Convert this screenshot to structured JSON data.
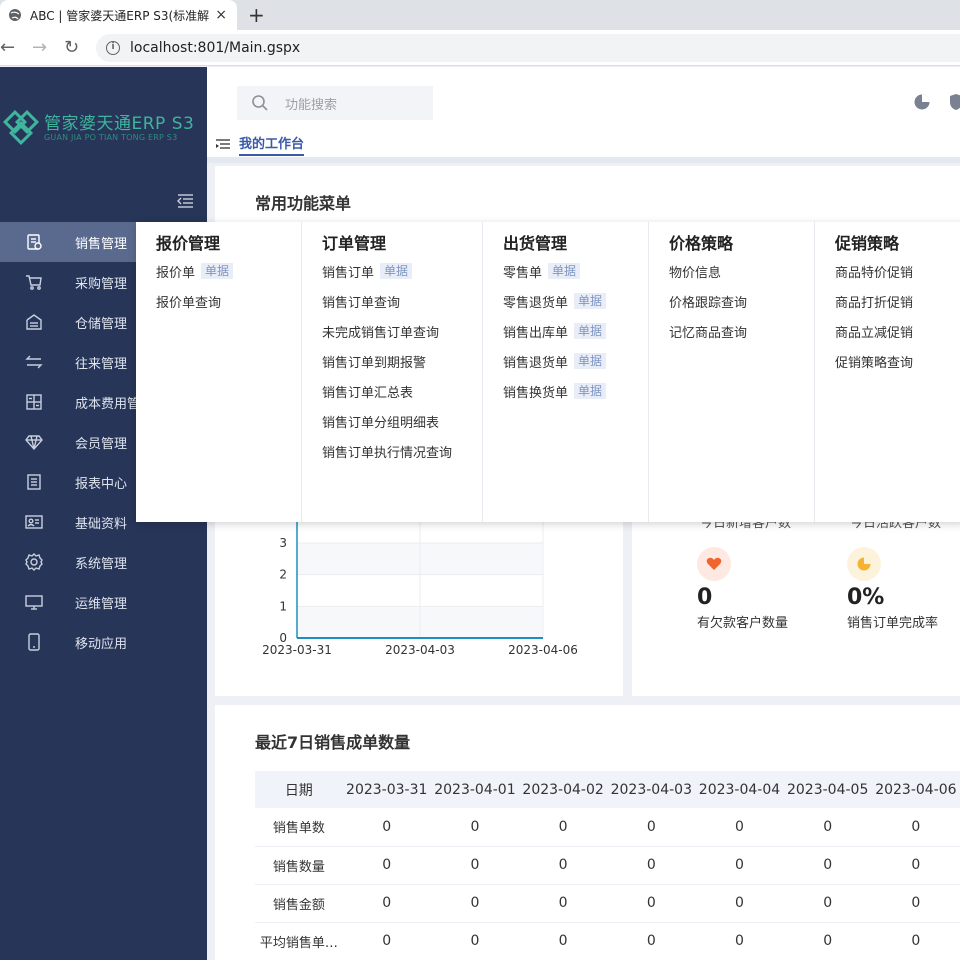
{
  "browser": {
    "tab_title": "ABC | 管家婆天通ERP S3(标准解",
    "tab_close": "×",
    "new_tab": "+",
    "url": "localhost:801/Main.gspx",
    "back": "←",
    "forward": "→",
    "reload": "↻"
  },
  "logo": {
    "name": "管家婆天通ERP S3",
    "pinyin": "GUAN JIA PO TIAN TONG ERP S3",
    "color": "#3eb59c"
  },
  "sidebar": {
    "items": [
      {
        "label": "销售管理",
        "icon": "document-icon",
        "active": true
      },
      {
        "label": "采购管理",
        "icon": "cart-icon"
      },
      {
        "label": "仓储管理",
        "icon": "warehouse-icon"
      },
      {
        "label": "往来管理",
        "icon": "exchange-icon"
      },
      {
        "label": "成本费用管",
        "icon": "calculator-icon"
      },
      {
        "label": "会员管理",
        "icon": "diamond-icon"
      },
      {
        "label": "报表中心",
        "icon": "report-icon"
      },
      {
        "label": "基础资料",
        "icon": "id-card-icon"
      },
      {
        "label": "系统管理",
        "icon": "gear-icon"
      },
      {
        "label": "运维管理",
        "icon": "monitor-icon"
      },
      {
        "label": "移动应用",
        "icon": "phone-icon"
      }
    ]
  },
  "header": {
    "search_placeholder": "功能搜索",
    "breadcrumb": "我的工作台"
  },
  "common_menu": {
    "title": "常用功能菜单"
  },
  "dropdown": {
    "columns": [
      {
        "title": "报价管理",
        "items": [
          {
            "label": "报价单",
            "tag": "单据"
          },
          {
            "label": "报价单查询",
            "tag": ""
          }
        ]
      },
      {
        "title": "订单管理",
        "items": [
          {
            "label": "销售订单",
            "tag": "单据"
          },
          {
            "label": "销售订单查询",
            "tag": ""
          },
          {
            "label": "未完成销售订单查询",
            "tag": ""
          },
          {
            "label": "销售订单到期报警",
            "tag": ""
          },
          {
            "label": "销售订单汇总表",
            "tag": ""
          },
          {
            "label": "销售订单分组明细表",
            "tag": ""
          },
          {
            "label": "销售订单执行情况查询",
            "tag": ""
          }
        ]
      },
      {
        "title": "出货管理",
        "items": [
          {
            "label": "零售单",
            "tag": "单据"
          },
          {
            "label": "零售退货单",
            "tag": "单据"
          },
          {
            "label": "销售出库单",
            "tag": "单据"
          },
          {
            "label": "销售退货单",
            "tag": "单据"
          },
          {
            "label": "销售换货单",
            "tag": "单据"
          }
        ]
      },
      {
        "title": "价格策略",
        "items": [
          {
            "label": "物价信息",
            "tag": ""
          },
          {
            "label": "价格跟踪查询",
            "tag": ""
          },
          {
            "label": "记忆商品查询",
            "tag": ""
          }
        ]
      },
      {
        "title": "促销策略",
        "items": [
          {
            "label": "商品特价促销",
            "tag": ""
          },
          {
            "label": "商品打折促销",
            "tag": ""
          },
          {
            "label": "商品立减促销",
            "tag": ""
          },
          {
            "label": "促销策略查询",
            "tag": ""
          }
        ]
      }
    ]
  },
  "chart_data": {
    "type": "line",
    "x": [
      "2023-03-31",
      "2023-04-03",
      "2023-04-06"
    ],
    "yticks": [
      0,
      1,
      2,
      3
    ],
    "ylim": [
      0,
      3
    ],
    "series": [
      {
        "values": [
          0,
          0,
          0
        ]
      }
    ],
    "grid": true,
    "accent": "#1c8fc0"
  },
  "stats": {
    "partial_label_1": "今日新增客户数",
    "partial_label_2": "今日活跃客户数",
    "debt": {
      "value": "0",
      "label": "有欠款客户数量",
      "icon": "heart-icon",
      "color": "#f0642d"
    },
    "completion": {
      "value": "0%",
      "label": "销售订单完成率",
      "icon": "pie-icon",
      "color": "#f5b333"
    }
  },
  "sales_table": {
    "title": "最近7日销售成单数量",
    "header_label": "日期",
    "dates": [
      "2023-03-31",
      "2023-04-01",
      "2023-04-02",
      "2023-04-03",
      "2023-04-04",
      "2023-04-05",
      "2023-04-06"
    ],
    "rows": [
      {
        "label": "销售单数",
        "values": [
          "0",
          "0",
          "0",
          "0",
          "0",
          "0",
          "0"
        ]
      },
      {
        "label": "销售数量",
        "values": [
          "0",
          "0",
          "0",
          "0",
          "0",
          "0",
          "0"
        ]
      },
      {
        "label": "销售金额",
        "values": [
          "0",
          "0",
          "0",
          "0",
          "0",
          "0",
          "0"
        ]
      },
      {
        "label": "平均销售单…",
        "values": [
          "0",
          "0",
          "0",
          "0",
          "0",
          "0",
          "0"
        ]
      }
    ]
  }
}
